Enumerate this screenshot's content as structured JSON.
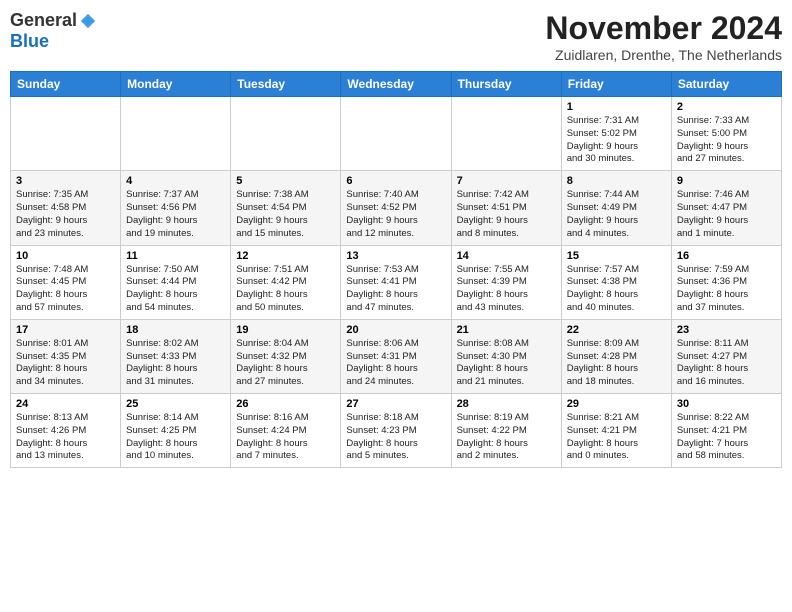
{
  "header": {
    "logo": {
      "general": "General",
      "blue": "Blue"
    },
    "title": "November 2024",
    "subtitle": "Zuidlaren, Drenthe, The Netherlands"
  },
  "days_of_week": [
    "Sunday",
    "Monday",
    "Tuesday",
    "Wednesday",
    "Thursday",
    "Friday",
    "Saturday"
  ],
  "weeks": [
    [
      {
        "day": "",
        "info": ""
      },
      {
        "day": "",
        "info": ""
      },
      {
        "day": "",
        "info": ""
      },
      {
        "day": "",
        "info": ""
      },
      {
        "day": "",
        "info": ""
      },
      {
        "day": "1",
        "info": "Sunrise: 7:31 AM\nSunset: 5:02 PM\nDaylight: 9 hours\nand 30 minutes."
      },
      {
        "day": "2",
        "info": "Sunrise: 7:33 AM\nSunset: 5:00 PM\nDaylight: 9 hours\nand 27 minutes."
      }
    ],
    [
      {
        "day": "3",
        "info": "Sunrise: 7:35 AM\nSunset: 4:58 PM\nDaylight: 9 hours\nand 23 minutes."
      },
      {
        "day": "4",
        "info": "Sunrise: 7:37 AM\nSunset: 4:56 PM\nDaylight: 9 hours\nand 19 minutes."
      },
      {
        "day": "5",
        "info": "Sunrise: 7:38 AM\nSunset: 4:54 PM\nDaylight: 9 hours\nand 15 minutes."
      },
      {
        "day": "6",
        "info": "Sunrise: 7:40 AM\nSunset: 4:52 PM\nDaylight: 9 hours\nand 12 minutes."
      },
      {
        "day": "7",
        "info": "Sunrise: 7:42 AM\nSunset: 4:51 PM\nDaylight: 9 hours\nand 8 minutes."
      },
      {
        "day": "8",
        "info": "Sunrise: 7:44 AM\nSunset: 4:49 PM\nDaylight: 9 hours\nand 4 minutes."
      },
      {
        "day": "9",
        "info": "Sunrise: 7:46 AM\nSunset: 4:47 PM\nDaylight: 9 hours\nand 1 minute."
      }
    ],
    [
      {
        "day": "10",
        "info": "Sunrise: 7:48 AM\nSunset: 4:45 PM\nDaylight: 8 hours\nand 57 minutes."
      },
      {
        "day": "11",
        "info": "Sunrise: 7:50 AM\nSunset: 4:44 PM\nDaylight: 8 hours\nand 54 minutes."
      },
      {
        "day": "12",
        "info": "Sunrise: 7:51 AM\nSunset: 4:42 PM\nDaylight: 8 hours\nand 50 minutes."
      },
      {
        "day": "13",
        "info": "Sunrise: 7:53 AM\nSunset: 4:41 PM\nDaylight: 8 hours\nand 47 minutes."
      },
      {
        "day": "14",
        "info": "Sunrise: 7:55 AM\nSunset: 4:39 PM\nDaylight: 8 hours\nand 43 minutes."
      },
      {
        "day": "15",
        "info": "Sunrise: 7:57 AM\nSunset: 4:38 PM\nDaylight: 8 hours\nand 40 minutes."
      },
      {
        "day": "16",
        "info": "Sunrise: 7:59 AM\nSunset: 4:36 PM\nDaylight: 8 hours\nand 37 minutes."
      }
    ],
    [
      {
        "day": "17",
        "info": "Sunrise: 8:01 AM\nSunset: 4:35 PM\nDaylight: 8 hours\nand 34 minutes."
      },
      {
        "day": "18",
        "info": "Sunrise: 8:02 AM\nSunset: 4:33 PM\nDaylight: 8 hours\nand 31 minutes."
      },
      {
        "day": "19",
        "info": "Sunrise: 8:04 AM\nSunset: 4:32 PM\nDaylight: 8 hours\nand 27 minutes."
      },
      {
        "day": "20",
        "info": "Sunrise: 8:06 AM\nSunset: 4:31 PM\nDaylight: 8 hours\nand 24 minutes."
      },
      {
        "day": "21",
        "info": "Sunrise: 8:08 AM\nSunset: 4:30 PM\nDaylight: 8 hours\nand 21 minutes."
      },
      {
        "day": "22",
        "info": "Sunrise: 8:09 AM\nSunset: 4:28 PM\nDaylight: 8 hours\nand 18 minutes."
      },
      {
        "day": "23",
        "info": "Sunrise: 8:11 AM\nSunset: 4:27 PM\nDaylight: 8 hours\nand 16 minutes."
      }
    ],
    [
      {
        "day": "24",
        "info": "Sunrise: 8:13 AM\nSunset: 4:26 PM\nDaylight: 8 hours\nand 13 minutes."
      },
      {
        "day": "25",
        "info": "Sunrise: 8:14 AM\nSunset: 4:25 PM\nDaylight: 8 hours\nand 10 minutes."
      },
      {
        "day": "26",
        "info": "Sunrise: 8:16 AM\nSunset: 4:24 PM\nDaylight: 8 hours\nand 7 minutes."
      },
      {
        "day": "27",
        "info": "Sunrise: 8:18 AM\nSunset: 4:23 PM\nDaylight: 8 hours\nand 5 minutes."
      },
      {
        "day": "28",
        "info": "Sunrise: 8:19 AM\nSunset: 4:22 PM\nDaylight: 8 hours\nand 2 minutes."
      },
      {
        "day": "29",
        "info": "Sunrise: 8:21 AM\nSunset: 4:21 PM\nDaylight: 8 hours\nand 0 minutes."
      },
      {
        "day": "30",
        "info": "Sunrise: 8:22 AM\nSunset: 4:21 PM\nDaylight: 7 hours\nand 58 minutes."
      }
    ]
  ]
}
